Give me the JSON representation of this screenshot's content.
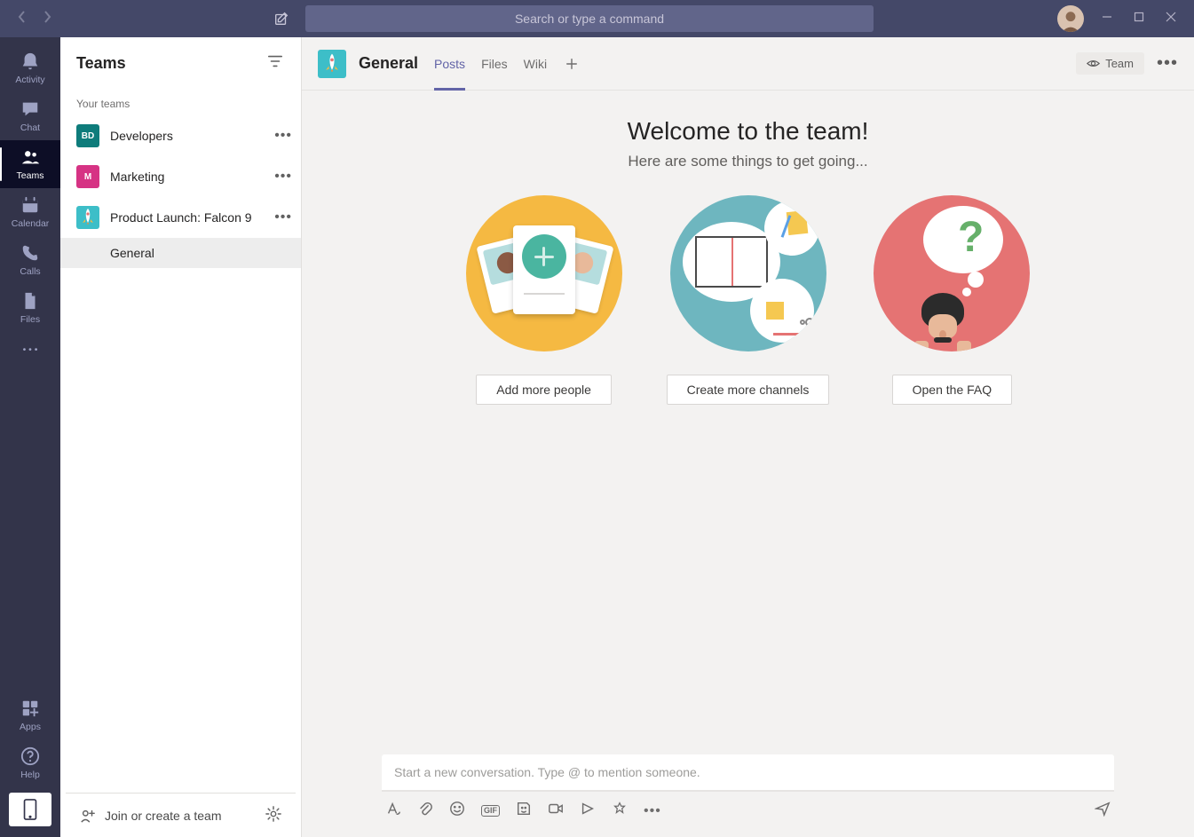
{
  "titlebar": {
    "search_placeholder": "Search or type a command"
  },
  "rail": {
    "items": [
      {
        "id": "activity",
        "label": "Activity"
      },
      {
        "id": "chat",
        "label": "Chat"
      },
      {
        "id": "teams",
        "label": "Teams"
      },
      {
        "id": "calendar",
        "label": "Calendar"
      },
      {
        "id": "calls",
        "label": "Calls"
      },
      {
        "id": "files",
        "label": "Files"
      }
    ],
    "apps_label": "Apps",
    "help_label": "Help"
  },
  "teams_panel": {
    "title": "Teams",
    "section": "Your teams",
    "teams": [
      {
        "initials": "BD",
        "name": "Developers",
        "color": "teal"
      },
      {
        "initials": "M",
        "name": "Marketing",
        "color": "pink"
      },
      {
        "initials": "",
        "name": "Product Launch: Falcon 9",
        "color": "falcon",
        "expanded": true,
        "channels": [
          {
            "name": "General",
            "selected": true
          }
        ]
      }
    ],
    "footer": "Join or create a team"
  },
  "main": {
    "channel_title": "General",
    "tabs": [
      {
        "label": "Posts",
        "active": true
      },
      {
        "label": "Files",
        "active": false
      },
      {
        "label": "Wiki",
        "active": false
      }
    ],
    "team_visibility_label": "Team",
    "welcome": {
      "title": "Welcome to the team!",
      "subtitle": "Here are some things to get going...",
      "cards": [
        {
          "button": "Add more people"
        },
        {
          "button": "Create more channels"
        },
        {
          "button": "Open the FAQ"
        }
      ]
    },
    "compose_placeholder": "Start a new conversation. Type @ to mention someone."
  }
}
